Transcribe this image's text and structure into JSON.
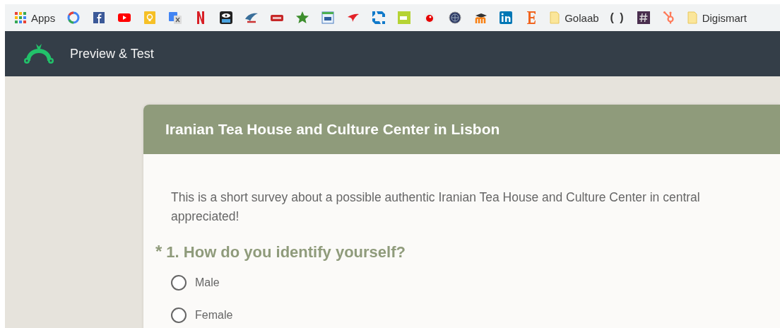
{
  "bookmarks": [
    {
      "kind": "apps",
      "label": "Apps"
    },
    {
      "kind": "site"
    },
    {
      "kind": "site"
    },
    {
      "kind": "site"
    },
    {
      "kind": "site"
    },
    {
      "kind": "site"
    },
    {
      "kind": "site"
    },
    {
      "kind": "site"
    },
    {
      "kind": "site"
    },
    {
      "kind": "site"
    },
    {
      "kind": "site"
    },
    {
      "kind": "site"
    },
    {
      "kind": "site"
    },
    {
      "kind": "site"
    },
    {
      "kind": "site"
    },
    {
      "kind": "site"
    },
    {
      "kind": "site"
    },
    {
      "kind": "site"
    },
    {
      "kind": "site"
    },
    {
      "kind": "site"
    },
    {
      "kind": "folder",
      "label": "Golaab"
    },
    {
      "kind": "text",
      "label": "( )"
    },
    {
      "kind": "site"
    },
    {
      "kind": "site"
    },
    {
      "kind": "folder",
      "label": "Digismart"
    }
  ],
  "header": {
    "title": "Preview & Test"
  },
  "survey": {
    "title": "Iranian Tea House and Culture Center in Lisbon",
    "intro_lines": [
      "This is a short survey about a possible authentic Iranian Tea House and Culture Center in central",
      "appreciated!"
    ],
    "question": {
      "required_mark": "*",
      "title": "1. How do you identify yourself?",
      "options": [
        {
          "label": "Male",
          "selected": false
        },
        {
          "label": "Female",
          "selected": false
        }
      ]
    }
  }
}
